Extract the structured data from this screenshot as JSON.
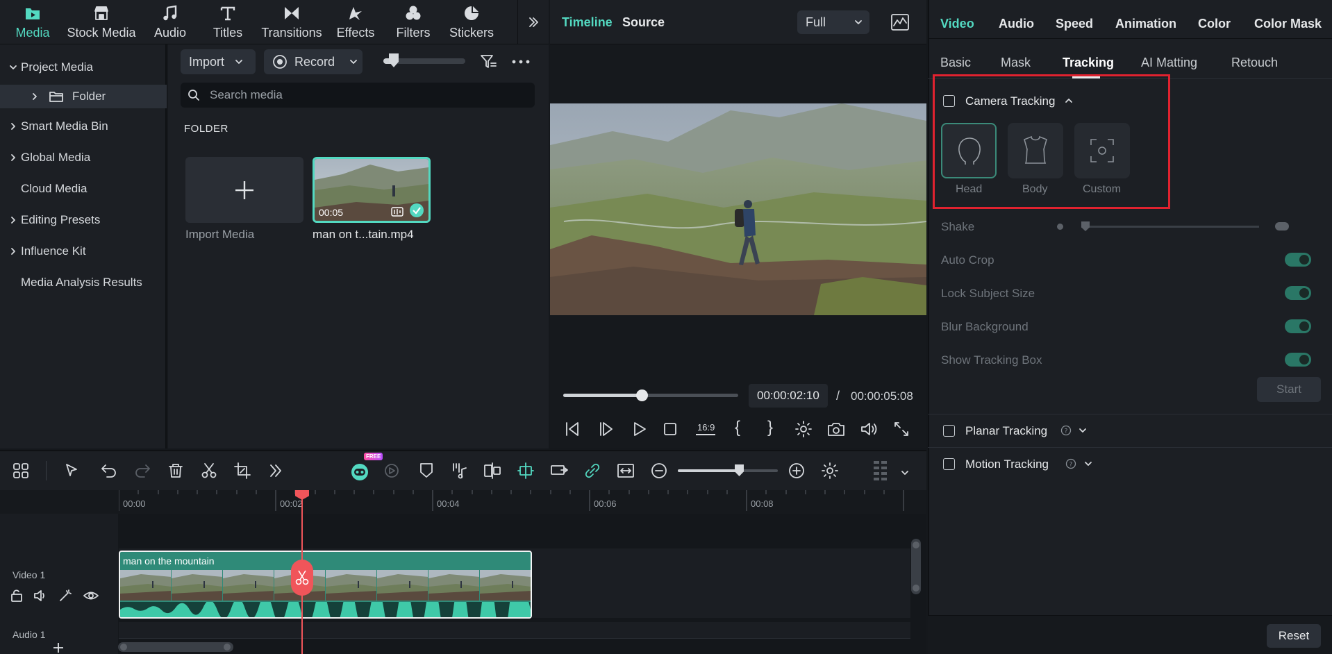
{
  "topbar": {
    "items": [
      {
        "label": "Media",
        "icon": "media-folder-icon",
        "active": true
      },
      {
        "label": "Stock Media",
        "icon": "store-icon"
      },
      {
        "label": "Audio",
        "icon": "music-note-icon"
      },
      {
        "label": "Titles",
        "icon": "text-t-icon"
      },
      {
        "label": "Transitions",
        "icon": "transitions-icon"
      },
      {
        "label": "Effects",
        "icon": "effects-sparkle-icon"
      },
      {
        "label": "Filters",
        "icon": "filters-circles-icon"
      },
      {
        "label": "Stickers",
        "icon": "sticker-icon"
      }
    ],
    "more_icon": "double-chevron-right-icon"
  },
  "sidebar": {
    "items": [
      {
        "label": "Project Media",
        "expanded": true
      },
      {
        "label": "Folder",
        "selected": true
      },
      {
        "label": "Smart Media Bin"
      },
      {
        "label": "Global Media"
      },
      {
        "label": "Cloud Media"
      },
      {
        "label": "Editing Presets"
      },
      {
        "label": "Influence Kit"
      },
      {
        "label": "Media Analysis Results"
      }
    ]
  },
  "media": {
    "import_label": "Import",
    "record_label": "Record",
    "search_placeholder": "Search media",
    "section_title": "FOLDER",
    "import_tile_label": "Import Media",
    "clip": {
      "name": "man on t...tain.mp4",
      "duration": "00:05"
    }
  },
  "preview": {
    "tab_timeline": "Timeline",
    "tab_source": "Source",
    "quality": "Full",
    "current_time": "00:00:02:10",
    "separator": "/",
    "total_time": "00:00:05:08",
    "progress": 0.45,
    "aspect_label": "16:9"
  },
  "right_panel": {
    "tabs": [
      "Video",
      "Audio",
      "Speed",
      "Animation",
      "Color",
      "Color Mask"
    ],
    "subtabs": [
      "Basic",
      "Mask",
      "Tracking",
      "AI Matting",
      "Retouch"
    ],
    "camera_tracking_label": "Camera Tracking",
    "modes": [
      {
        "label": "Head",
        "icon": "head-outline-icon",
        "selected": true
      },
      {
        "label": "Body",
        "icon": "body-torso-icon"
      },
      {
        "label": "Custom",
        "icon": "custom-target-icon"
      }
    ],
    "shake_label": "Shake",
    "options": [
      {
        "label": "Auto Crop",
        "on": true
      },
      {
        "label": "Lock Subject Size",
        "on": true
      },
      {
        "label": "Blur Background",
        "on": true
      },
      {
        "label": "Show Tracking Box",
        "on": true
      }
    ],
    "start_label": "Start",
    "planar_label": "Planar Tracking",
    "motion_label": "Motion Tracking",
    "reset_label": "Reset",
    "colors": {
      "accent": "#53d9c1",
      "highlight_box": "#e0222f",
      "toggle_on": "#2a7766"
    }
  },
  "timeline": {
    "ticks": [
      "00:00",
      "00:02",
      "00:04",
      "00:06",
      "00:08"
    ],
    "free_badge": "FREE",
    "track_video_label": "Video 1",
    "track_audio_label": "Audio 1",
    "clip_title": "man on the mountain",
    "playhead_color": "#f0555a",
    "clip_color": "#2f8a78"
  }
}
